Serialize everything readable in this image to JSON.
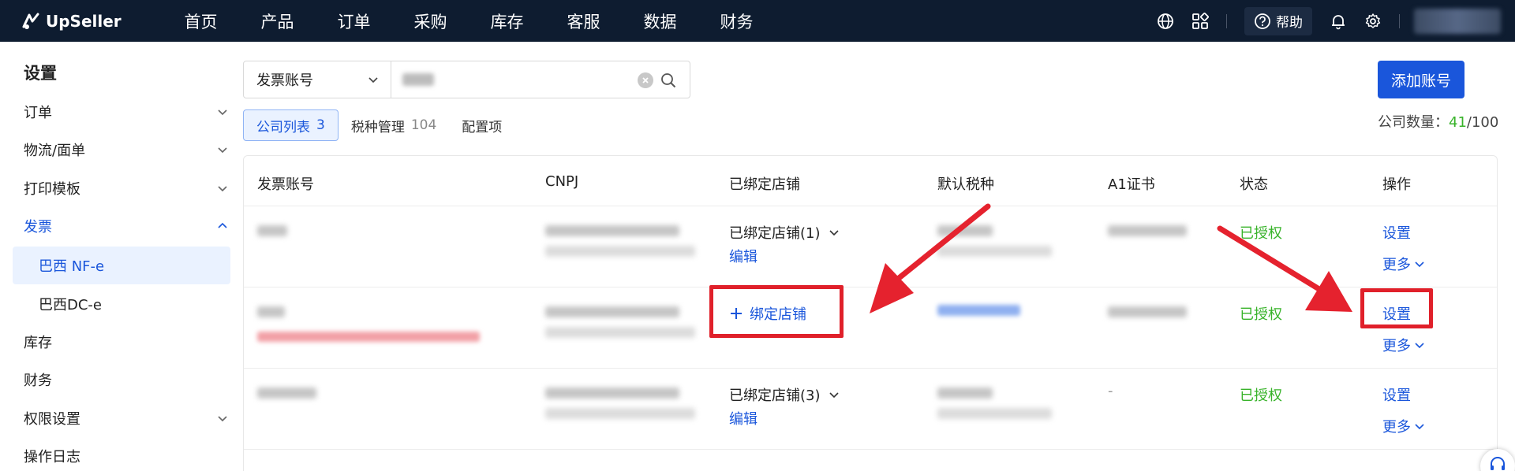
{
  "app": {
    "brand": "UpSeller"
  },
  "topnav": {
    "items": [
      "首页",
      "产品",
      "订单",
      "采购",
      "库存",
      "客服",
      "数据",
      "财务"
    ],
    "help_label": "帮助"
  },
  "sidebar": {
    "title": "设置",
    "items": [
      {
        "label": "订单"
      },
      {
        "label": "物流/面单"
      },
      {
        "label": "打印模板"
      },
      {
        "label": "发票"
      },
      {
        "label": "库存"
      },
      {
        "label": "财务"
      },
      {
        "label": "权限设置"
      },
      {
        "label": "操作日志"
      }
    ],
    "sub_items": [
      {
        "label": "巴西 NF-e"
      },
      {
        "label": "巴西DC-e"
      }
    ]
  },
  "search": {
    "field_select": "发票账号"
  },
  "actions": {
    "add_account": "添加账号"
  },
  "tabs": [
    {
      "label": "公司列表",
      "count": "3"
    },
    {
      "label": "税种管理",
      "count": "104"
    },
    {
      "label": "配置项",
      "count": ""
    }
  ],
  "company_count": {
    "label": "公司数量：",
    "current": "41",
    "total": "/100"
  },
  "table": {
    "headers": [
      "发票账号",
      "CNPJ",
      "已绑定店铺",
      "默认税种",
      "A1证书",
      "状态",
      "操作"
    ],
    "rows": [
      {
        "bound_shops": "已绑定店铺(1)",
        "edit": "编辑",
        "status": "已授权",
        "setting": "设置",
        "more": "更多"
      },
      {
        "bind_shop": "绑定店铺",
        "status": "已授权",
        "setting": "设置",
        "more": "更多"
      },
      {
        "bound_shops": "已绑定店铺(3)",
        "edit": "编辑",
        "a1_cert": "-",
        "status": "已授权",
        "setting": "设置",
        "more": "更多"
      }
    ]
  },
  "colors": {
    "topbar": "#0e1c30",
    "primary": "#1a56db",
    "success": "#38b32a",
    "annotation": "#e0202a"
  }
}
